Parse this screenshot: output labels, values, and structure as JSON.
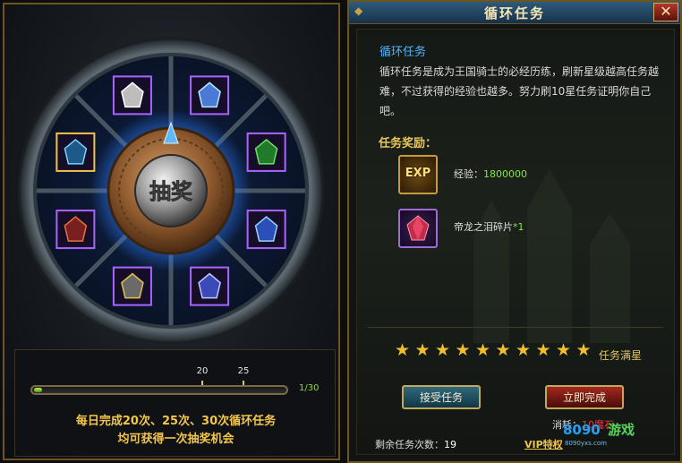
{
  "lottery": {
    "center_label": "抽奖",
    "slots": [
      "wheel-slot-gift-bag",
      "wheel-slot-gift-box",
      "wheel-slot-diamond",
      "wheel-slot-opal-gem",
      "wheel-slot-clover",
      "wheel-slot-blue-gem",
      "wheel-slot-crystal",
      "wheel-slot-padlock"
    ],
    "progress": {
      "current": 1,
      "max": 30,
      "count_text": "1/30",
      "markers": [
        "20",
        "25"
      ]
    },
    "tip_line1": "每日完成20次、25次、30次循环任务",
    "tip_line2": "均可获得一次抽奖机会"
  },
  "window": {
    "title": "循环任务",
    "close_label": "✕"
  },
  "mission": {
    "title": "循环任务",
    "description": "循环任务是成为王国骑士的必经历练，刷新星级越高任务越难，不过获得的经验也越多。努力刷10星任务证明你自己吧。"
  },
  "rewards": {
    "heading": "任务奖励：",
    "items": [
      {
        "icon": "exp-icon",
        "icon_text": "EXP",
        "label": "经验：",
        "value": "1800000"
      },
      {
        "icon": "dragon-tear-fragment-icon",
        "label": "帝龙之泪碎片",
        "value": "*1"
      }
    ]
  },
  "stars": {
    "filled": 10,
    "total": 10,
    "label": "任务满星"
  },
  "buttons": {
    "accept": "接受任务",
    "complete": "立即完成"
  },
  "cost": {
    "label": "消耗：",
    "value": "10魔石"
  },
  "remaining": {
    "label": "剩余任务次数：",
    "value": "19"
  },
  "vip_link": "VIP特权",
  "watermark": {
    "text_left": "8090",
    "text_right": "游戏",
    "domain": "8090yxs.com"
  }
}
